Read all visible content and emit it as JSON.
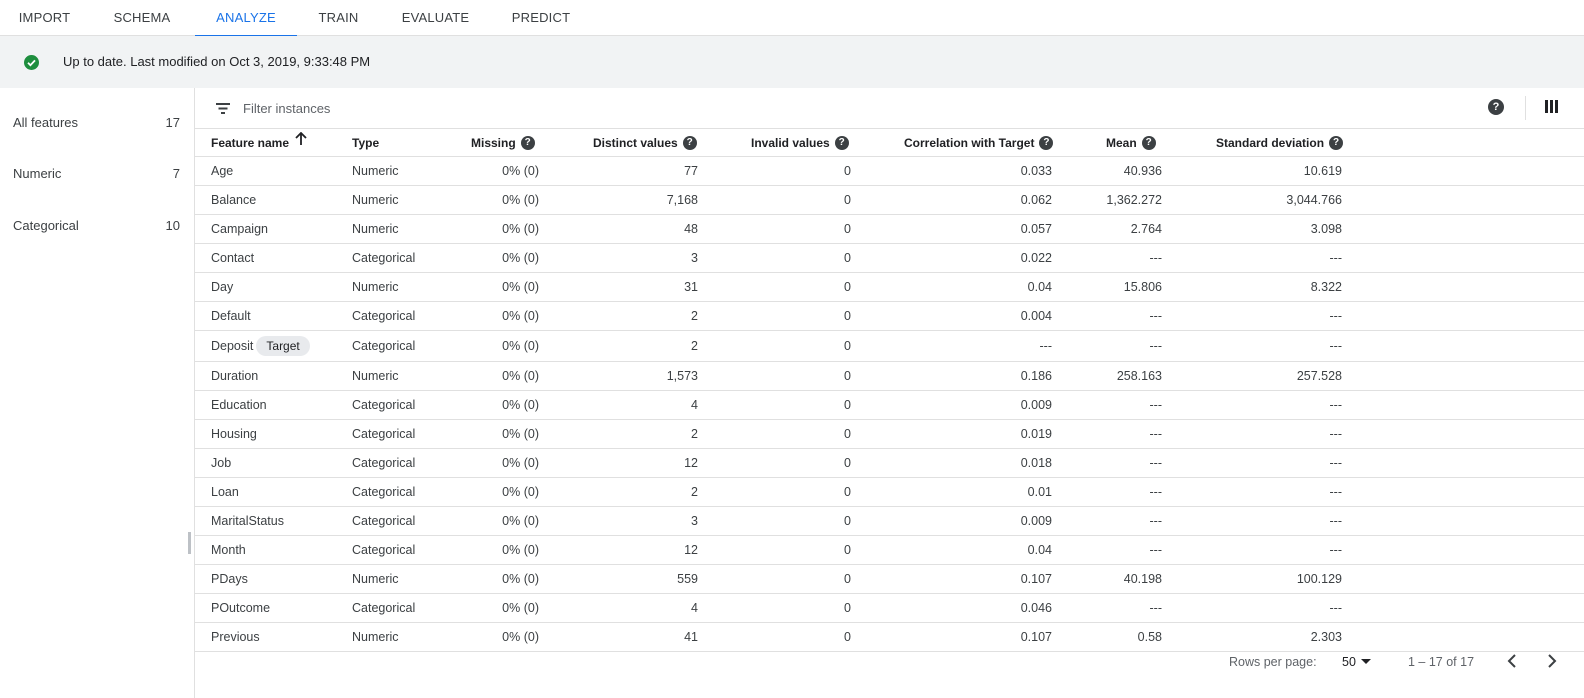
{
  "tabs": [
    {
      "label": "IMPORT",
      "active": false
    },
    {
      "label": "SCHEMA",
      "active": false
    },
    {
      "label": "ANALYZE",
      "active": true
    },
    {
      "label": "TRAIN",
      "active": false
    },
    {
      "label": "EVALUATE",
      "active": false
    },
    {
      "label": "PREDICT",
      "active": false
    }
  ],
  "status": {
    "text": "Up to date. Last modified on Oct 3, 2019, 9:33:48 PM",
    "icon": "check-circle-icon",
    "color": "#1e8e3e"
  },
  "sidebar": {
    "items": [
      {
        "label": "All features",
        "count": "17"
      },
      {
        "label": "Numeric",
        "count": "7"
      },
      {
        "label": "Categorical",
        "count": "10"
      }
    ]
  },
  "filter": {
    "placeholder": "Filter instances",
    "value": ""
  },
  "table": {
    "headers": {
      "feature_name": "Feature name",
      "type": "Type",
      "missing": "Missing",
      "distinct": "Distinct values",
      "invalid": "Invalid values",
      "correlation": "Correlation with Target",
      "mean": "Mean",
      "std": "Standard deviation"
    },
    "help_glyph": "?",
    "rows": [
      {
        "name": "Age",
        "badge": "",
        "type": "Numeric",
        "missing": "0% (0)",
        "distinct": "77",
        "invalid": "0",
        "correlation": "0.033",
        "mean": "40.936",
        "std": "10.619"
      },
      {
        "name": "Balance",
        "badge": "",
        "type": "Numeric",
        "missing": "0% (0)",
        "distinct": "7,168",
        "invalid": "0",
        "correlation": "0.062",
        "mean": "1,362.272",
        "std": "3,044.766"
      },
      {
        "name": "Campaign",
        "badge": "",
        "type": "Numeric",
        "missing": "0% (0)",
        "distinct": "48",
        "invalid": "0",
        "correlation": "0.057",
        "mean": "2.764",
        "std": "3.098"
      },
      {
        "name": "Contact",
        "badge": "",
        "type": "Categorical",
        "missing": "0% (0)",
        "distinct": "3",
        "invalid": "0",
        "correlation": "0.022",
        "mean": "---",
        "std": "---"
      },
      {
        "name": "Day",
        "badge": "",
        "type": "Numeric",
        "missing": "0% (0)",
        "distinct": "31",
        "invalid": "0",
        "correlation": "0.04",
        "mean": "15.806",
        "std": "8.322"
      },
      {
        "name": "Default",
        "badge": "",
        "type": "Categorical",
        "missing": "0% (0)",
        "distinct": "2",
        "invalid": "0",
        "correlation": "0.004",
        "mean": "---",
        "std": "---"
      },
      {
        "name": "Deposit",
        "badge": "Target",
        "type": "Categorical",
        "missing": "0% (0)",
        "distinct": "2",
        "invalid": "0",
        "correlation": "---",
        "mean": "---",
        "std": "---"
      },
      {
        "name": "Duration",
        "badge": "",
        "type": "Numeric",
        "missing": "0% (0)",
        "distinct": "1,573",
        "invalid": "0",
        "correlation": "0.186",
        "mean": "258.163",
        "std": "257.528"
      },
      {
        "name": "Education",
        "badge": "",
        "type": "Categorical",
        "missing": "0% (0)",
        "distinct": "4",
        "invalid": "0",
        "correlation": "0.009",
        "mean": "---",
        "std": "---"
      },
      {
        "name": "Housing",
        "badge": "",
        "type": "Categorical",
        "missing": "0% (0)",
        "distinct": "2",
        "invalid": "0",
        "correlation": "0.019",
        "mean": "---",
        "std": "---"
      },
      {
        "name": "Job",
        "badge": "",
        "type": "Categorical",
        "missing": "0% (0)",
        "distinct": "12",
        "invalid": "0",
        "correlation": "0.018",
        "mean": "---",
        "std": "---"
      },
      {
        "name": "Loan",
        "badge": "",
        "type": "Categorical",
        "missing": "0% (0)",
        "distinct": "2",
        "invalid": "0",
        "correlation": "0.01",
        "mean": "---",
        "std": "---"
      },
      {
        "name": "MaritalStatus",
        "badge": "",
        "type": "Categorical",
        "missing": "0% (0)",
        "distinct": "3",
        "invalid": "0",
        "correlation": "0.009",
        "mean": "---",
        "std": "---"
      },
      {
        "name": "Month",
        "badge": "",
        "type": "Categorical",
        "missing": "0% (0)",
        "distinct": "12",
        "invalid": "0",
        "correlation": "0.04",
        "mean": "---",
        "std": "---"
      },
      {
        "name": "PDays",
        "badge": "",
        "type": "Numeric",
        "missing": "0% (0)",
        "distinct": "559",
        "invalid": "0",
        "correlation": "0.107",
        "mean": "40.198",
        "std": "100.129"
      },
      {
        "name": "POutcome",
        "badge": "",
        "type": "Categorical",
        "missing": "0% (0)",
        "distinct": "4",
        "invalid": "0",
        "correlation": "0.046",
        "mean": "---",
        "std": "---"
      },
      {
        "name": "Previous",
        "badge": "",
        "type": "Numeric",
        "missing": "0% (0)",
        "distinct": "41",
        "invalid": "0",
        "correlation": "0.107",
        "mean": "0.58",
        "std": "2.303"
      }
    ]
  },
  "pagination": {
    "rows_per_page_label": "Rows per page:",
    "rows_per_page_value": "50",
    "range": "1 – 17 of 17"
  },
  "colors": {
    "accent": "#1a73e8",
    "success": "#1e8e3e",
    "status_bg": "#f1f3f4"
  }
}
